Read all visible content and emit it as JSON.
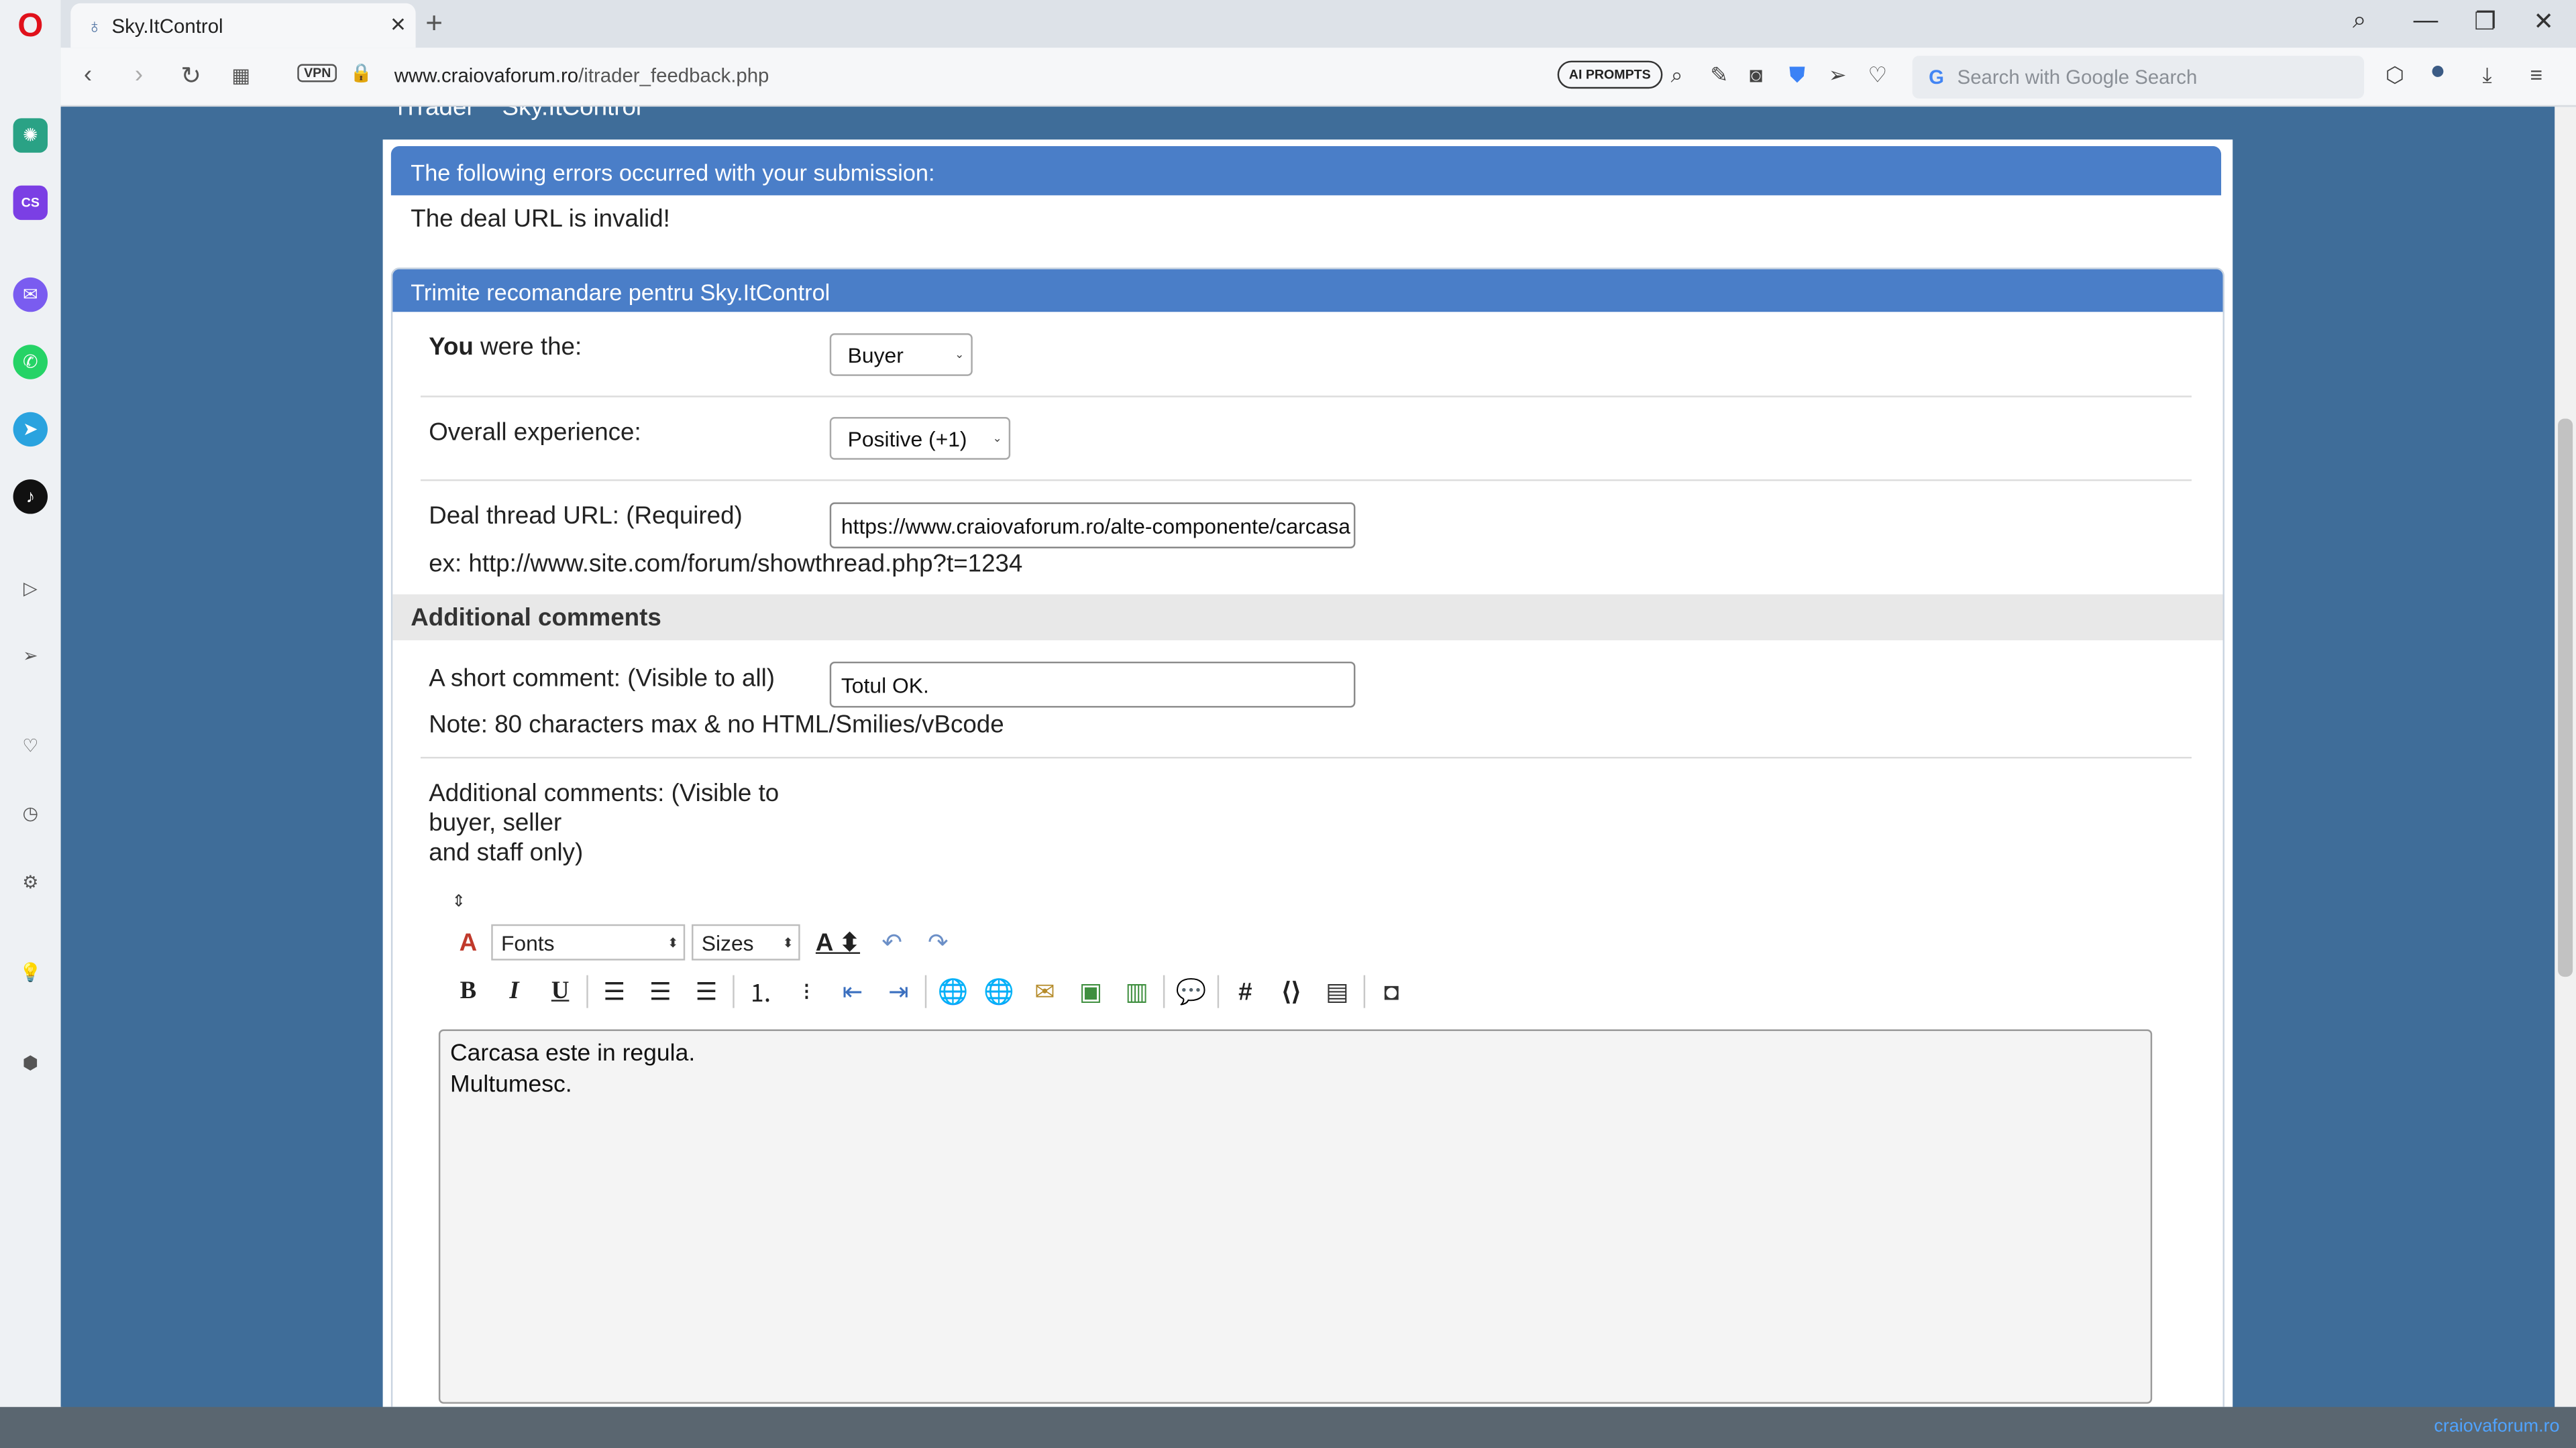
{
  "browser": {
    "tab_title": "Sky.ItControl",
    "new_tab": "+",
    "url_host": "www.craiovaforum.ro",
    "url_path": "/itrader_feedback.php",
    "vpn": "VPN",
    "ai_prompts": "AI PROMPTS",
    "search_placeholder": "Search with Google Search",
    "icons": [
      "back-icon",
      "forward-icon",
      "reload-icon",
      "speed-dial-icon",
      "lock-icon",
      "search-icon",
      "minimize-icon",
      "maximize-icon",
      "close-icon",
      "lens-icon",
      "edit-icon",
      "camera-icon",
      "shield-icon",
      "send-icon",
      "heart-icon",
      "box-icon",
      "profile-icon",
      "download-icon",
      "menu-icon"
    ]
  },
  "sidebar": {
    "items": [
      "opera-logo",
      "chatgpt-icon",
      "cs-icon",
      "messenger-icon",
      "whatsapp-icon",
      "telegram-icon",
      "tiktok-icon",
      "player-icon",
      "send-icon",
      "heart-icon",
      "history-icon",
      "settings-icon",
      "lightbulb-icon",
      "extensions-icon"
    ],
    "cs_label": "CS",
    "more": "···"
  },
  "page": {
    "breadcrumb_a": "iTrader",
    "breadcrumb_b": "Sky.ItControl",
    "error_header": "The following errors occurred with your submission:",
    "error_message": "The deal URL is invalid!",
    "form_header": "Trimite recomandare pentru Sky.ItControl",
    "you_were_bold": "You",
    "you_were_rest": " were the:",
    "role_value": "Buyer",
    "experience_label": "Overall experience:",
    "experience_value": "Positive (+1)",
    "url_label": "Deal thread URL: (Required)",
    "url_value": "https://www.craiovaforum.ro/alte-componente/carcasa",
    "url_example": "ex: http://www.site.com/forum/showthread.php?t=1234",
    "additional_section": "Additional comments",
    "short_label": "A short comment: (Visible to all)",
    "short_value": "Totul OK.",
    "short_note": "Note: 80 characters max & no HTML/Smilies/vBcode",
    "additional_label_1": "Additional comments: (Visible to",
    "additional_label_2": "buyer, seller",
    "additional_label_3": "and staff only)",
    "font_select": "Fonts",
    "size_select": "Sizes",
    "editor_line_1": "Carcasa este in regula.",
    "editor_line_2": "Multumesc.",
    "watermark": "craiovaforum.ro"
  }
}
